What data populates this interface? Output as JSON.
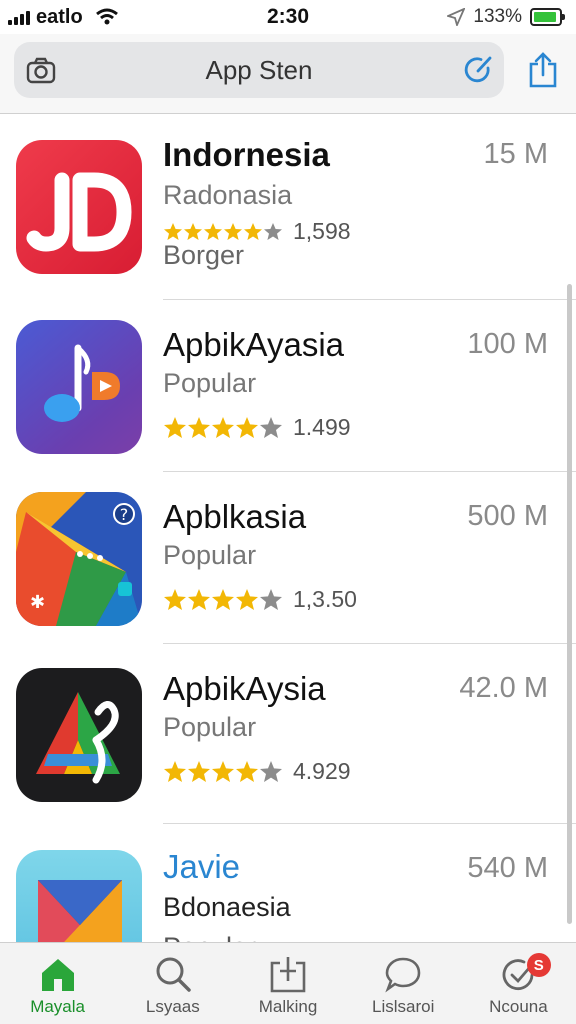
{
  "status_bar": {
    "carrier": "eatlo",
    "time": "2:30",
    "battery_percent": "133%",
    "battery_level": 0.9
  },
  "toolbar": {
    "title": "App Sten",
    "camera_icon": "camera-icon",
    "refresh_icon": "refresh-icon",
    "share_icon": "share-icon"
  },
  "apps": [
    {
      "name": "Indornesia",
      "size": "15 M",
      "subtitle": "Radonasia",
      "rating_count": "1,598",
      "extra": "Borger",
      "stars": 4.5
    },
    {
      "name": "ApbikAyasia",
      "size": "100 M",
      "subtitle": "Popular",
      "rating_count": "1.499",
      "stars": 4
    },
    {
      "name": "Apblkasia",
      "size": "500 M",
      "subtitle": "Popular",
      "rating_count": "1,3.50",
      "stars": 4
    },
    {
      "name": "ApbikAysia",
      "size": "42.0 M",
      "subtitle": "Popular",
      "rating_count": "4.929",
      "stars": 4
    },
    {
      "name": "Javie",
      "size": "540 M",
      "subtitle": "Bdonaesia",
      "extra": "Popular"
    }
  ],
  "tabs": [
    {
      "label": "Mayala",
      "icon": "home-icon",
      "active": true
    },
    {
      "label": "Lsyaas",
      "icon": "search-icon"
    },
    {
      "label": "Malking",
      "icon": "add-icon"
    },
    {
      "label": "Lislsaroi",
      "icon": "chat-icon"
    },
    {
      "label": "Ncouna",
      "icon": "notification-icon",
      "badge": "S"
    }
  ],
  "colors": {
    "accent": "#2a86d1",
    "tab_active": "#1a8f2a",
    "star": "#f2b705",
    "badge": "#e53935"
  }
}
